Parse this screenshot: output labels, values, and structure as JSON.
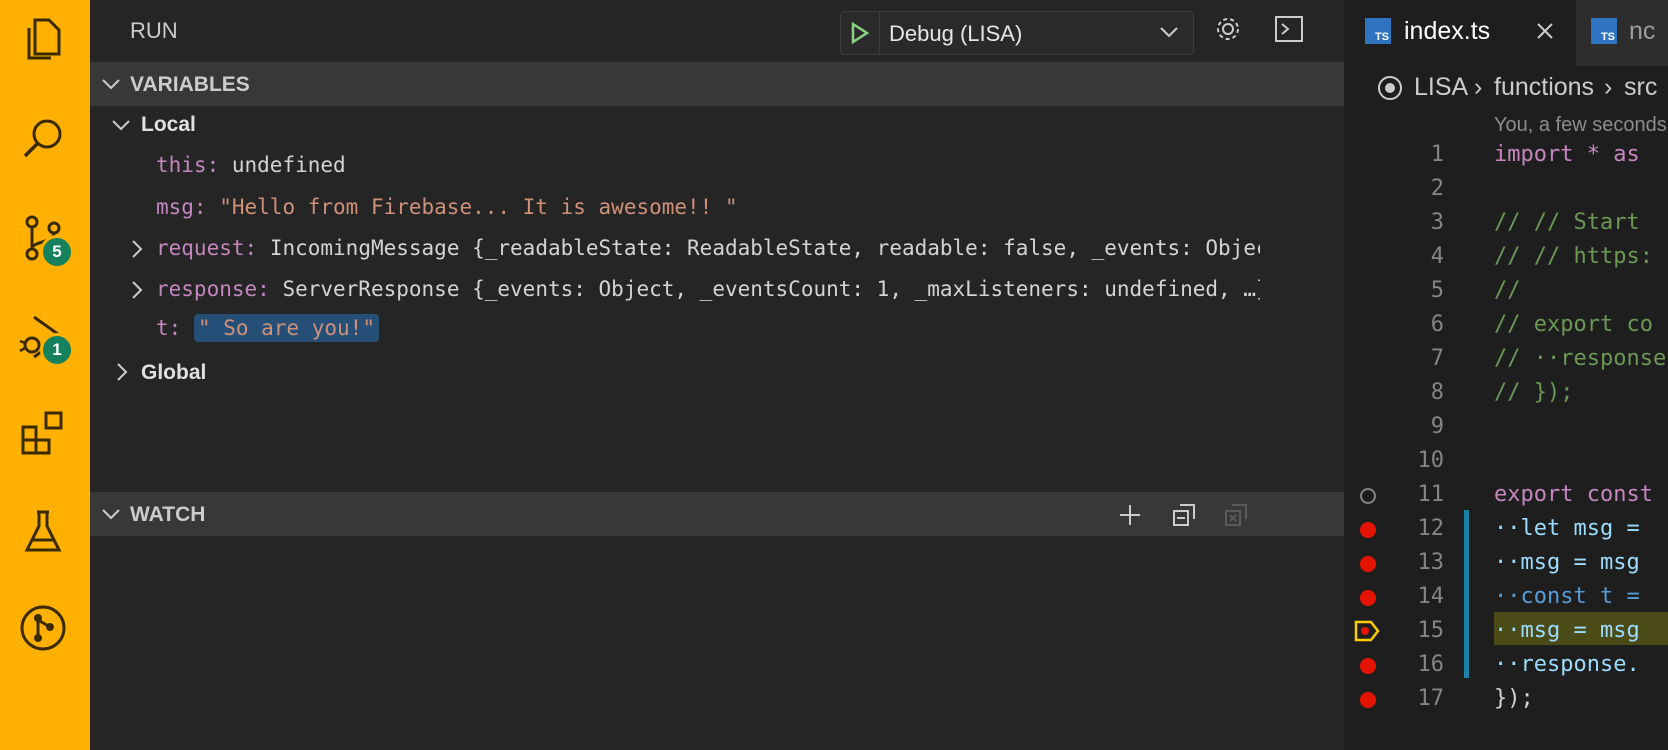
{
  "activity_bar": {
    "badges": {
      "source_control": "5",
      "run_debug": "1"
    }
  },
  "run_panel": {
    "title": "RUN",
    "config_label": "Debug (LISA)"
  },
  "variables": {
    "header": "VARIABLES",
    "local_label": "Local",
    "global_label": "Global",
    "items": [
      {
        "name": "this:",
        "value": "undefined"
      },
      {
        "name": "msg:",
        "value": "\"Hello from Firebase... It is awesome!! \""
      },
      {
        "name": "request:",
        "value": "IncomingMessage {_readableState: ReadableState, readable: false, _events: Objec…"
      },
      {
        "name": "response:",
        "value": "ServerResponse {_events: Object, _eventsCount: 1, _maxListeners: undefined, …}"
      },
      {
        "name": "t:",
        "value": "\" So are you!\""
      }
    ]
  },
  "watch": {
    "header": "WATCH"
  },
  "editor": {
    "tabs": [
      {
        "badge": "TS",
        "label": "index.ts"
      },
      {
        "badge": "TS",
        "label": "nc"
      }
    ],
    "breadcrumb": {
      "root": "LISA",
      "folder": "functions",
      "next": "src"
    },
    "blame": "You, a few seconds",
    "lines": [
      {
        "n": "1",
        "text": "import * as"
      },
      {
        "n": "2",
        "text": ""
      },
      {
        "n": "3",
        "text": "// // Start"
      },
      {
        "n": "4",
        "text": "// // https:"
      },
      {
        "n": "5",
        "text": "//"
      },
      {
        "n": "6",
        "text": "// export co"
      },
      {
        "n": "7",
        "text": "// ··response"
      },
      {
        "n": "8",
        "text": "// });"
      },
      {
        "n": "9",
        "text": ""
      },
      {
        "n": "10",
        "text": ""
      },
      {
        "n": "11",
        "text": "export const"
      },
      {
        "n": "12",
        "text": "··let msg ="
      },
      {
        "n": "13",
        "text": "··msg = msg"
      },
      {
        "n": "14",
        "text": "··const t ="
      },
      {
        "n": "15",
        "text": "··msg = msg"
      },
      {
        "n": "16",
        "text": "··response."
      },
      {
        "n": "17",
        "text": "});"
      }
    ]
  }
}
